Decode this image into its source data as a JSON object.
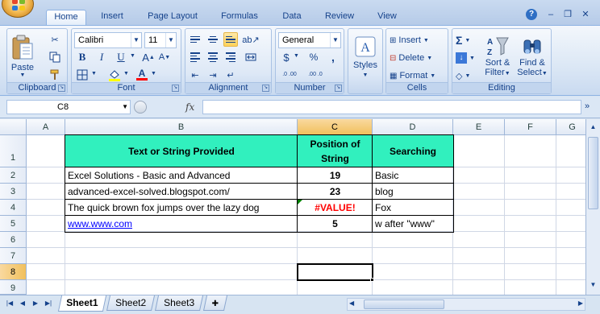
{
  "ribbon_tabs": [
    "Home",
    "Insert",
    "Page Layout",
    "Formulas",
    "Data",
    "Review",
    "View"
  ],
  "active_tab": "Home",
  "clipboard": {
    "paste": "Paste",
    "group_label": "Clipboard"
  },
  "font": {
    "name": "Calibri",
    "size": "11",
    "bold": "B",
    "italic": "I",
    "underline": "U",
    "grow": "A",
    "shrink": "A",
    "color_letter": "A",
    "group_label": "Font"
  },
  "alignment": {
    "group_label": "Alignment"
  },
  "number": {
    "format": "General",
    "currency": "$",
    "percent": "%",
    "comma": ",",
    "inc_decimal": ".0 .00",
    "dec_decimal": ".00 .0",
    "group_label": "Number"
  },
  "styles": {
    "label": "Styles"
  },
  "cells": {
    "insert": "Insert",
    "delete": "Delete",
    "format": "Format",
    "group_label": "Cells"
  },
  "editing": {
    "sigma": "Σ",
    "sort": "Sort &",
    "filter": "Filter",
    "find": "Find &",
    "select": "Select",
    "group_label": "Editing"
  },
  "formula_bar": {
    "name_box": "C8",
    "fx": "fx",
    "formula": ""
  },
  "columns": [
    "A",
    "B",
    "C",
    "D",
    "E",
    "F",
    "G"
  ],
  "selected_column": "C",
  "rows": [
    "1",
    "2",
    "3",
    "4",
    "5",
    "6",
    "7",
    "8",
    "9"
  ],
  "selected_row": "8",
  "table": {
    "headers": [
      "Text or String Provided",
      "Position of String",
      "Searching"
    ],
    "rows": [
      {
        "text": "Excel Solutions - Basic and Advanced",
        "position": "19",
        "search": "Basic"
      },
      {
        "text": "advanced-excel-solved.blogspot.com/",
        "position": "23",
        "search": "blog"
      },
      {
        "text": "The quick brown fox jumps over the lazy dog",
        "position": "#VALUE!",
        "search": "Fox"
      },
      {
        "text": "www.www.com",
        "position": "5",
        "search": "w after \"www\""
      }
    ]
  },
  "sheet_tabs": [
    "Sheet1",
    "Sheet2",
    "Sheet3"
  ],
  "active_sheet": "Sheet1",
  "colors": {
    "header_fill": "#31f0be",
    "error_text": "#ff0000",
    "link_text": "#0000ff",
    "selection_header": "#f1c05c"
  }
}
